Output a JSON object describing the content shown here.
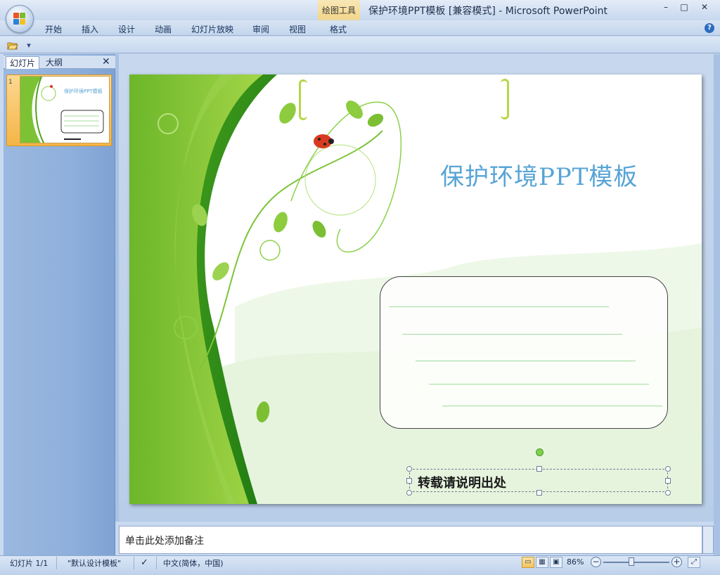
{
  "window": {
    "title": "保护环境PPT模板 [兼容模式] - Microsoft PowerPoint",
    "contextual_tools_label": "绘图工具",
    "minimize": "–",
    "maximize": "□",
    "close": "✕"
  },
  "ribbon": {
    "tabs": [
      "开始",
      "插入",
      "设计",
      "动画",
      "幻灯片放映",
      "审阅",
      "视图",
      "格式"
    ],
    "help": "?"
  },
  "quick_access": {
    "open_icon": "folder-open-icon",
    "dropdown": "▾"
  },
  "left_pane": {
    "tabs": [
      "幻灯片",
      "大纲"
    ],
    "close": "✕",
    "thumbnail_number": "1",
    "thumbnail_title": "保护环境PPT模板"
  },
  "slide": {
    "title": "保护环境PPT模板",
    "caption": "转载请说明出处",
    "accent_green": "#6fc22f",
    "title_color": "#57a4d6"
  },
  "notes": {
    "placeholder": "单击此处添加备注"
  },
  "status": {
    "slide_counter": "幻灯片 1/1",
    "theme": "\"默认设计模板\"",
    "language": "中文(简体，中国)",
    "zoom": "86%",
    "zoom_minus": "−",
    "zoom_plus": "+"
  }
}
